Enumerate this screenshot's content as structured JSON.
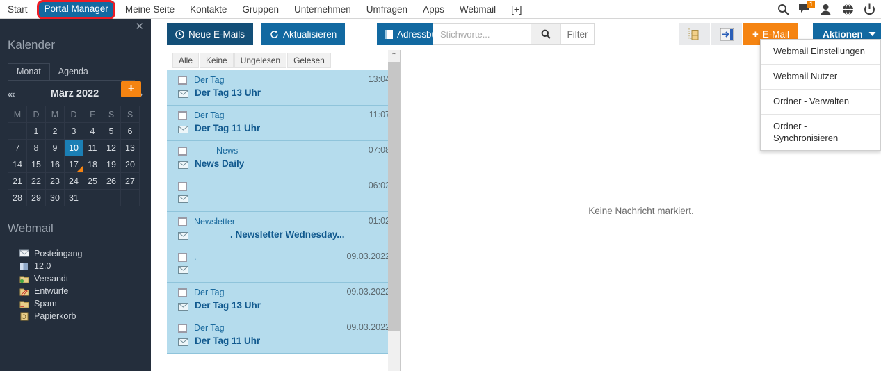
{
  "topnav": {
    "items": [
      {
        "label": "Start",
        "active": false
      },
      {
        "label": "Portal Manager",
        "active": true
      },
      {
        "label": "Meine Seite",
        "active": false
      },
      {
        "label": "Kontakte",
        "active": false
      },
      {
        "label": "Gruppen",
        "active": false
      },
      {
        "label": "Unternehmen",
        "active": false
      },
      {
        "label": "Umfragen",
        "active": false
      },
      {
        "label": "Apps",
        "active": false
      },
      {
        "label": "Webmail",
        "active": false
      },
      {
        "label": "[+]",
        "active": false
      }
    ],
    "icons": [
      {
        "name": "search-icon"
      },
      {
        "name": "chat-icon",
        "badge": "1"
      },
      {
        "name": "user-icon"
      },
      {
        "name": "globe-icon"
      },
      {
        "name": "power-icon"
      }
    ],
    "highlight_color": "#ee1c25",
    "active_color": "#1269a1"
  },
  "sidebar": {
    "close_label": "✕",
    "calendar": {
      "title": "Kalender",
      "tabs": [
        {
          "label": "Monat",
          "active": true
        },
        {
          "label": "Agenda",
          "active": false
        }
      ],
      "add_label": "+",
      "prev_label": "«‹",
      "next_label": "›»",
      "month_label": "März 2022",
      "weekdays": [
        "M",
        "D",
        "M",
        "D",
        "F",
        "S",
        "S"
      ],
      "weeks": [
        [
          null,
          1,
          2,
          3,
          4,
          5,
          6
        ],
        [
          7,
          8,
          9,
          10,
          11,
          12,
          13
        ],
        [
          14,
          15,
          16,
          17,
          18,
          19,
          20
        ],
        [
          21,
          22,
          23,
          24,
          25,
          26,
          27
        ],
        [
          28,
          29,
          30,
          31,
          null,
          null,
          null
        ]
      ],
      "selected_day": 10,
      "marked_day": 17,
      "selected_color": "#1b7fb5",
      "marker_color": "#f58412"
    },
    "webmail": {
      "title": "Webmail",
      "folders": [
        {
          "label": "Posteingang",
          "icon": "inbox-envelope-icon"
        },
        {
          "label": "12.0",
          "icon": "folder-open-icon"
        },
        {
          "label": "Versandt",
          "icon": "folder-sent-icon"
        },
        {
          "label": "Entwürfe",
          "icon": "folder-draft-icon"
        },
        {
          "label": "Spam",
          "icon": "folder-spam-icon"
        },
        {
          "label": "Papierkorb",
          "icon": "trash-icon"
        }
      ]
    }
  },
  "toolbar": {
    "new_mails_label": "Neue E-Mails",
    "refresh_label": "Aktualisieren",
    "addressbook_label": "Adressbuch",
    "search_value": "",
    "search_placeholder": "Stichworte...",
    "filter_label": "Filter",
    "icon_buttons": [
      {
        "name": "folder-tree-icon"
      },
      {
        "name": "move-to-folder-icon"
      }
    ],
    "email_label": "E-Mail",
    "email_plus": "+",
    "actions_label": "Aktionen",
    "actions_caret": "⌄",
    "email_color": "#f58412",
    "actions_color": "#1269a1"
  },
  "dropdown": {
    "items": [
      "Webmail Einstellungen",
      "Webmail Nutzer",
      "Ordner - Verwalten",
      "Ordner - Synchronisieren"
    ]
  },
  "message_list": {
    "filters": [
      "Alle",
      "Keine",
      "Ungelesen",
      "Gelesen"
    ],
    "messages": [
      {
        "from": "Der Tag",
        "time": "13:04",
        "subject": "Der Tag 13 Uhr",
        "indent": false
      },
      {
        "from": "Der Tag",
        "time": "11:07",
        "subject": "Der Tag 11 Uhr",
        "indent": false
      },
      {
        "from": "News",
        "time": "07:08",
        "subject": "News Daily",
        "indent": false
      },
      {
        "from": "",
        "time": "06:02",
        "subject": "",
        "indent": false
      },
      {
        "from": "Newsletter",
        "time": "01:02",
        "subject": ". Newsletter Wednesday...",
        "indent": true
      },
      {
        "from": ".",
        "time": "09.03.2022",
        "subject": "",
        "indent": false
      },
      {
        "from": "Der Tag",
        "time": "09.03.2022",
        "subject": "Der Tag 13 Uhr",
        "indent": false
      },
      {
        "from": "Der Tag",
        "time": "09.03.2022",
        "subject": "Der Tag 11 Uhr",
        "indent": false
      }
    ],
    "row_color": "#b5dced",
    "scroll_up_label": "⌃"
  },
  "reading_pane": {
    "empty_message": "Keine Nachricht markiert."
  }
}
